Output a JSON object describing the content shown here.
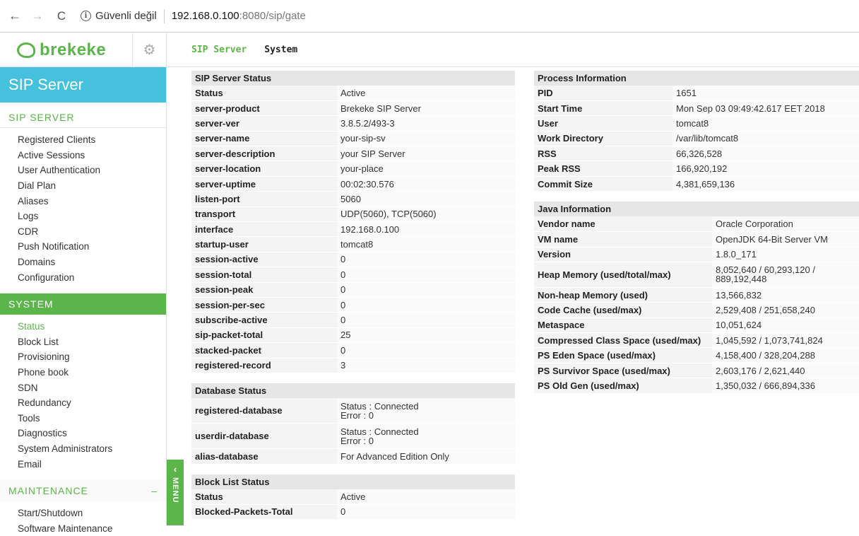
{
  "browser": {
    "back": "←",
    "forward": "→",
    "reload": "C",
    "info_symbol": "i",
    "security_text": "Güvenli değil",
    "url_host": "192.168.0.100",
    "url_rest": ":8080/sip/gate"
  },
  "sidebar": {
    "logo_text": "brekeke",
    "gear": "⚙",
    "app_title": "SIP Server",
    "sip_section": "SIP SERVER",
    "sip_items": [
      "Registered Clients",
      "Active Sessions",
      "User Authentication",
      "Dial Plan",
      "Aliases",
      "Logs",
      "CDR",
      "Push Notification",
      "Domains",
      "Configuration"
    ],
    "system_section": "SYSTEM",
    "system_items": [
      "Status",
      "Block List",
      "Provisioning",
      "Phone book",
      "SDN",
      "Redundancy",
      "Tools",
      "Diagnostics",
      "System Administrators",
      "Email"
    ],
    "maintenance_section": "MAINTENANCE",
    "maintenance_toggle": "–",
    "maintenance_items": [
      "Start/Shutdown",
      "Software Maintenance"
    ],
    "menu_tab_label": "MENU",
    "menu_tab_chevron": "‹"
  },
  "tabs": [
    "SIP Server",
    "System"
  ],
  "sip_status": {
    "caption": "SIP Server Status",
    "rows": [
      [
        "Status",
        "Active"
      ],
      [
        "server-product",
        "Brekeke SIP Server"
      ],
      [
        "server-ver",
        "3.8.5.2/493-3"
      ],
      [
        "server-name",
        "your-sip-sv"
      ],
      [
        "server-description",
        "your SIP Server"
      ],
      [
        "server-location",
        "your-place"
      ],
      [
        "server-uptime",
        "00:02:30.576"
      ],
      [
        "listen-port",
        "5060"
      ],
      [
        "transport",
        "UDP(5060), TCP(5060)"
      ],
      [
        "interface",
        "192.168.0.100"
      ],
      [
        "startup-user",
        "tomcat8"
      ],
      [
        "session-active",
        "0"
      ],
      [
        "session-total",
        "0"
      ],
      [
        "session-peak",
        "0"
      ],
      [
        "session-per-sec",
        "0"
      ],
      [
        "subscribe-active",
        "0"
      ],
      [
        "sip-packet-total",
        "25"
      ],
      [
        "stacked-packet",
        "0"
      ],
      [
        "registered-record",
        "3"
      ]
    ]
  },
  "db_status": {
    "caption": "Database Status",
    "rows": [
      [
        "registered-database",
        "Status : Connected",
        "Error : 0"
      ],
      [
        "userdir-database",
        "Status : Connected",
        "Error : 0"
      ],
      [
        "alias-database",
        "For Advanced Edition Only",
        ""
      ]
    ]
  },
  "block_status": {
    "caption": "Block List Status",
    "rows": [
      [
        "Status",
        "Active"
      ],
      [
        "Blocked-Packets-Total",
        "0"
      ]
    ]
  },
  "process_info": {
    "caption": "Process Information",
    "rows": [
      [
        "PID",
        "1651"
      ],
      [
        "Start Time",
        "Mon Sep 03 09:49:42.617 EET 2018"
      ],
      [
        "User",
        "tomcat8"
      ],
      [
        "Work Directory",
        "/var/lib/tomcat8"
      ],
      [
        "RSS",
        "66,326,528"
      ],
      [
        "Peak RSS",
        "166,920,192"
      ],
      [
        "Commit Size",
        "4,381,659,136"
      ]
    ]
  },
  "java_info": {
    "caption": "Java Information",
    "rows": [
      [
        "Vendor name",
        "Oracle Corporation",
        ""
      ],
      [
        "VM name",
        "OpenJDK 64-Bit Server VM",
        ""
      ],
      [
        "Version",
        "1.8.0_171",
        ""
      ],
      [
        "Heap Memory (used/total/max)",
        "8,052,640 / 60,293,120 /",
        "889,192,448"
      ],
      [
        "Non-heap Memory (used)",
        "13,566,832",
        ""
      ],
      [
        "Code Cache (used/max)",
        "2,529,408 / 251,658,240",
        ""
      ],
      [
        "Metaspace",
        "10,051,624",
        ""
      ],
      [
        "Compressed Class Space (used/max)",
        "1,045,592 / 1,073,741,824",
        ""
      ],
      [
        "PS Eden Space (used/max)",
        "4,158,400 / 328,204,288",
        ""
      ],
      [
        "PS Survivor Space (used/max)",
        "2,603,176 / 2,621,440",
        ""
      ],
      [
        "PS Old Gen (used/max)",
        "1,350,032 / 666,894,336",
        ""
      ]
    ]
  }
}
